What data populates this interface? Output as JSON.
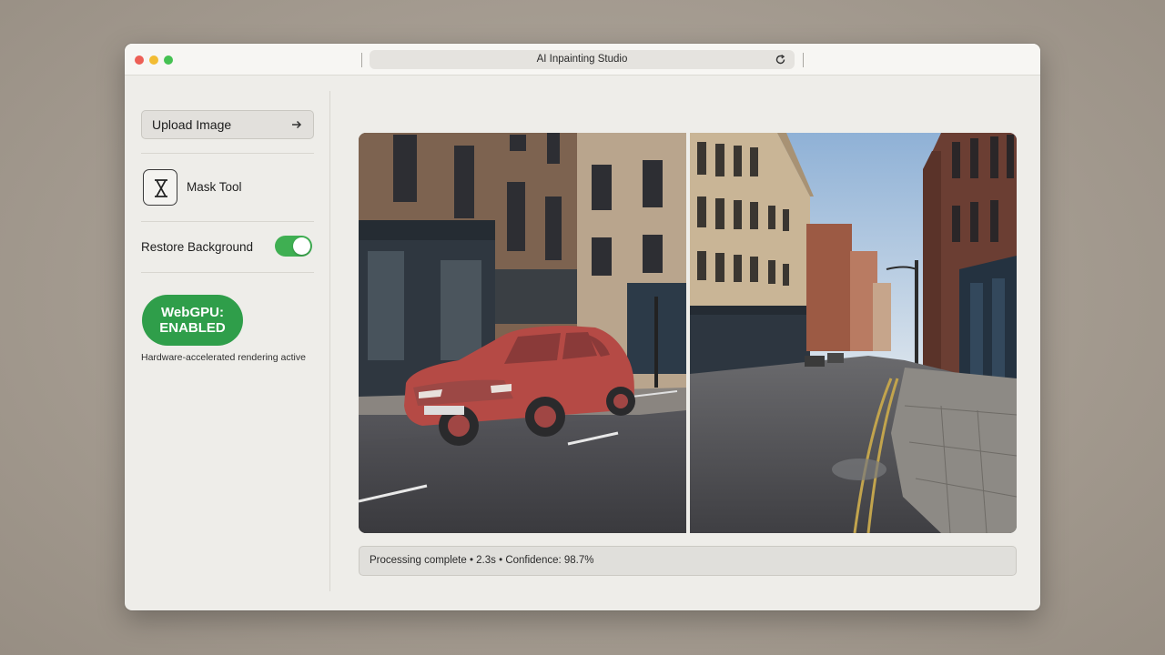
{
  "window": {
    "title": "AI Inpainting Studio"
  },
  "sidebar": {
    "upload_label": "Upload Image",
    "mask_tool_label": "Mask Tool",
    "restore_background_label": "Restore Background",
    "restore_background_enabled": true,
    "webgpu_badge_line1": "WebGPU:",
    "webgpu_badge_line2": "ENABLED",
    "hardware_note": "Hardware-accelerated rendering active"
  },
  "preview": {
    "before_label": "original with car masked",
    "after_label": "inpainted result with car removed",
    "mask_color": "#c83a3a"
  },
  "status": {
    "text": "Processing complete • 2.3s • Confidence: 98.7%"
  },
  "colors": {
    "accent_green": "#3faf52",
    "badge_green": "#2f9e4a"
  },
  "icons": {
    "reload": "reload-icon",
    "upload": "arrow-right-icon",
    "mask": "hourglass-mask-icon"
  }
}
